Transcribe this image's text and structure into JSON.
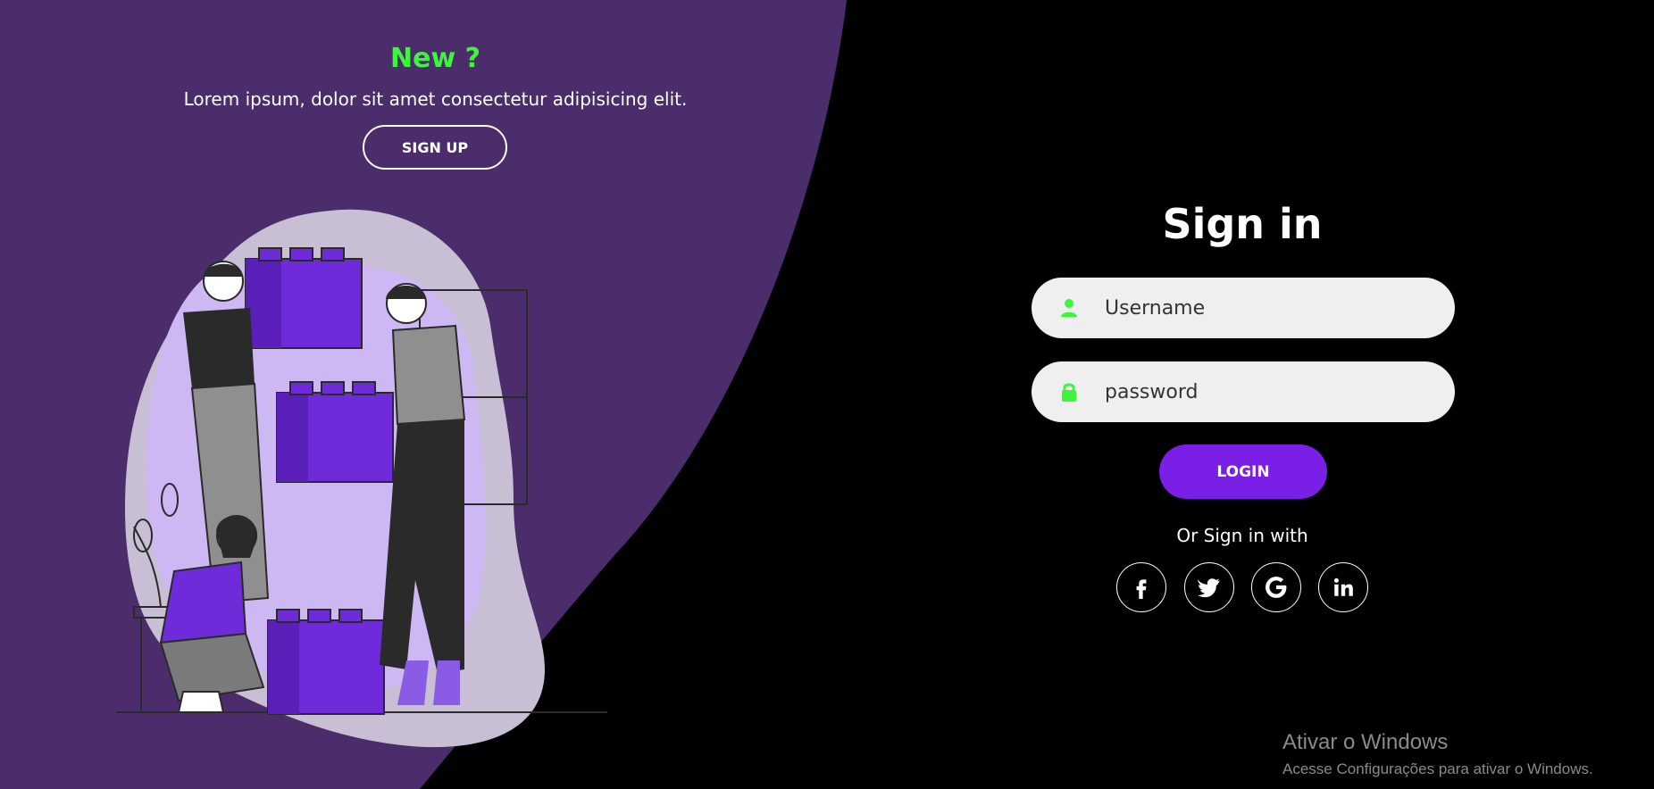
{
  "left_panel": {
    "title": "New ?",
    "text": "Lorem ipsum, dolor sit amet consectetur adipisicing elit.",
    "signup_label": "SIGN UP"
  },
  "form": {
    "title": "Sign in",
    "username_placeholder": "Username",
    "password_placeholder": "password",
    "login_label": "LOGIN",
    "or_text": "Or Sign in with",
    "social": [
      {
        "icon": "facebook-icon"
      },
      {
        "icon": "twitter-icon"
      },
      {
        "icon": "google-icon"
      },
      {
        "icon": "linkedin-icon"
      }
    ]
  },
  "windows_watermark": {
    "title": "Ativar o Windows",
    "subtitle": "Acesse Configurações para ativar o Windows."
  },
  "colors": {
    "panel": "#4b2d6b",
    "accent_green": "#3cf53c",
    "button_purple": "#7a1fe6",
    "background": "#000000",
    "input_bg": "#efefef"
  }
}
